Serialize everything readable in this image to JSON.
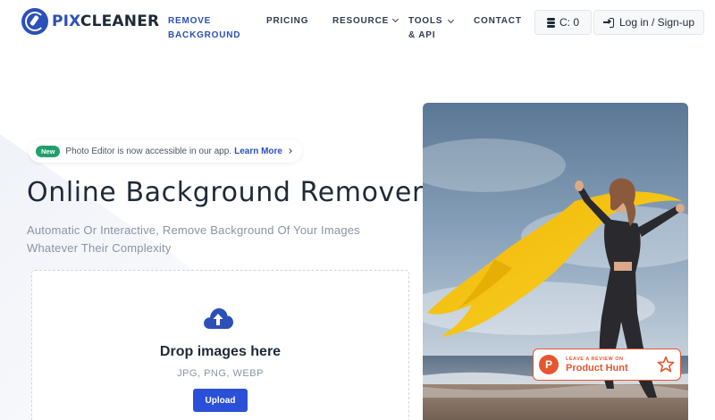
{
  "brand": {
    "pix": "PIX",
    "cleaner": "CLEANER"
  },
  "nav": {
    "remove_background_line1": "REMOVE",
    "remove_background_line2": "BACKGROUND",
    "pricing": "PRICING",
    "resource": "RESOURCE",
    "tools_line1": "TOOLS",
    "tools_line2": "& API",
    "contact": "CONTACT"
  },
  "account": {
    "credits": "C: 0",
    "login": "Log in / Sign-up"
  },
  "announcement": {
    "badge": "New",
    "text": "Photo Editor is now accessible in our app.",
    "link": "Learn More"
  },
  "hero": {
    "title": "Online Background Remover",
    "subtitle": "Automatic Or Interactive, Remove Background Of Your Images Whatever Their Complexity"
  },
  "dropzone": {
    "title": "Drop images here",
    "formats": "JPG, PNG, WEBP",
    "button": "Upload"
  },
  "product_hunt": {
    "small": "LEAVE A REVIEW ON",
    "big": "Product Hunt",
    "logo_letter": "P"
  },
  "colors": {
    "brand_blue": "#2b50b8",
    "button_blue": "#2b50d8",
    "badge_green": "#22a06b",
    "product_hunt": "#e5572f"
  }
}
